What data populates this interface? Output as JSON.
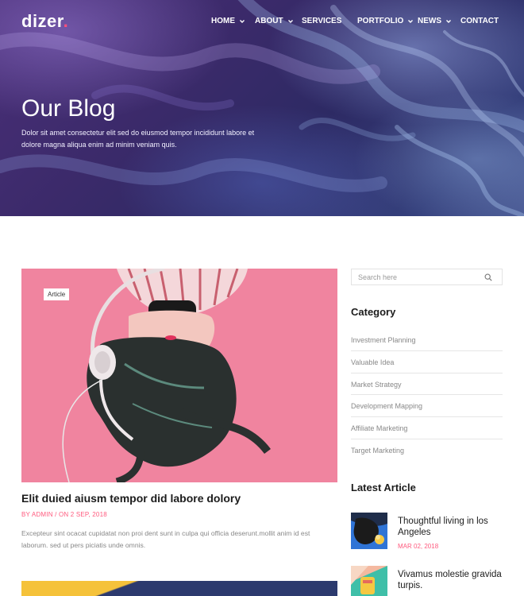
{
  "brand": {
    "name": "dizer",
    "dot": ".",
    "accent": "#ff4f7b"
  },
  "nav": {
    "items": [
      {
        "label": "HOME",
        "dropdown": true
      },
      {
        "label": "ABOUT",
        "dropdown": true
      },
      {
        "label": "SERVICES",
        "dropdown": false
      },
      {
        "label": "PORTFOLIO",
        "dropdown": true
      },
      {
        "label": "NEWS",
        "dropdown": true
      },
      {
        "label": "CONTACT",
        "dropdown": false
      }
    ]
  },
  "hero": {
    "title": "Our Blog",
    "subtitle": "Dolor sit amet consectetur elit sed do eiusmod tempor incididunt labore et dolore magna aliqua enim ad minim veniam quis."
  },
  "post": {
    "tag": "Article",
    "title": "Elit duied aiusm tempor did labore dolory",
    "meta": "BY ADMIN / ON 2 SEP, 2018",
    "excerpt": "Excepteur sint ocacat cupidatat non proi dent sunt in culpa qui officia deserunt.mollit anim id est laborum. sed ut pers piciatis unde omnis."
  },
  "sidebar": {
    "search_placeholder": "Search here",
    "category_heading": "Category",
    "categories": [
      "Investment Planning",
      "Valuable Idea",
      "Market Strategy",
      "Development Mapping",
      "Affiliate Marketing",
      "Target Marketing"
    ],
    "latest_heading": "Latest Article",
    "latest": [
      {
        "title": "Thoughtful living in los Angeles",
        "date": "MAR 02, 2018"
      },
      {
        "title": "Vivamus molestie gravida turpis.",
        "date": ""
      }
    ]
  },
  "icons": {
    "search": "search-icon",
    "dropdown": "chevron-down-icon"
  },
  "colors": {
    "accent": "#ff5a7e",
    "hero_bg": "#3b2a6a",
    "post_image_bg": "#f0849f"
  }
}
